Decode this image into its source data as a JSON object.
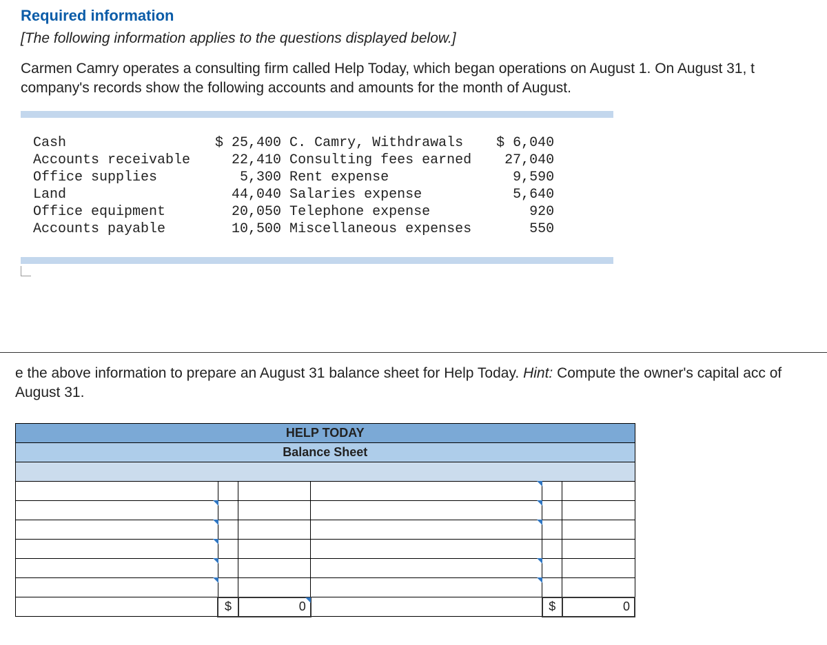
{
  "header": {
    "required": "Required information",
    "italic": "[The following information applies to the questions displayed below.]",
    "body": "Carmen Camry operates a consulting firm called Help Today, which began operations on August 1. On August 31, t company's records show the following accounts and amounts for the month of August."
  },
  "accounts": {
    "left": [
      {
        "name": "Cash",
        "amount": "$ 25,400"
      },
      {
        "name": "Accounts receivable",
        "amount": "22,410"
      },
      {
        "name": "Office supplies",
        "amount": "5,300"
      },
      {
        "name": "Land",
        "amount": "44,040"
      },
      {
        "name": "Office equipment",
        "amount": "20,050"
      },
      {
        "name": "Accounts payable",
        "amount": "10,500"
      }
    ],
    "right": [
      {
        "name": "C. Camry, Withdrawals",
        "amount": "$ 6,040"
      },
      {
        "name": "Consulting fees earned",
        "amount": "27,040"
      },
      {
        "name": "Rent expense",
        "amount": "9,590"
      },
      {
        "name": "Salaries expense",
        "amount": "5,640"
      },
      {
        "name": "Telephone expense",
        "amount": "920"
      },
      {
        "name": "Miscellaneous expenses",
        "amount": "550"
      }
    ]
  },
  "instruction": {
    "text_prefix": "e the above information to prepare an August 31 balance sheet for Help Today. ",
    "hint_label": "Hint:",
    "text_suffix": " Compute the owner's capital acc of August 31."
  },
  "balance_sheet": {
    "company": "HELP TODAY",
    "title": "Balance Sheet",
    "currency": "$",
    "zero": "0"
  }
}
